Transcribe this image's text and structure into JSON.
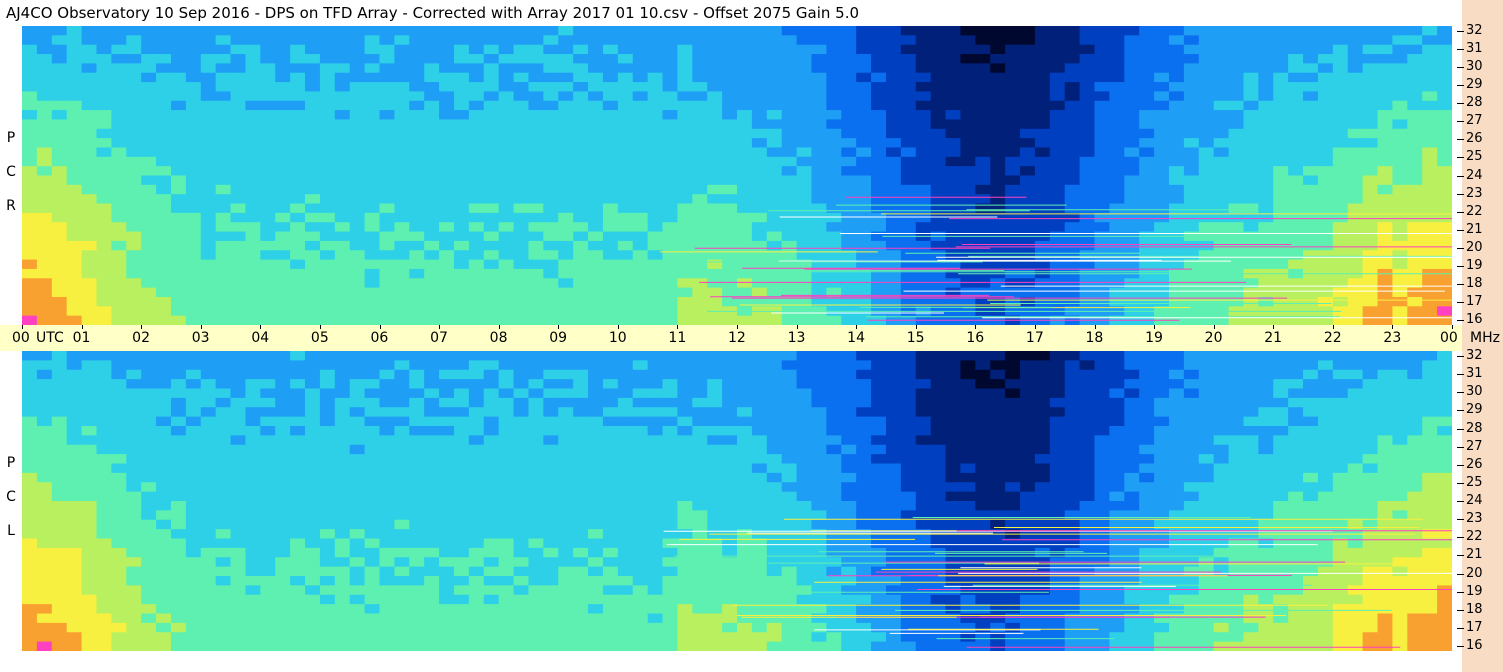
{
  "title": "AJ4CO Observatory  10 Sep 2016  -  DPS on TFD Array  -  Corrected with Array 2017 01 10.csv  -  Offset 2075  Gain 5.0",
  "chart_data": {
    "type": "heatmap",
    "title": "AJ4CO Observatory  10 Sep 2016  -  DPS on TFD Array  -  Corrected with Array 2017 01 10.csv  -  Offset 2075  Gain 5.0",
    "x_axis": {
      "label": "UTC",
      "range": [
        0,
        24
      ],
      "tick_labels": [
        "00",
        "01",
        "02",
        "03",
        "04",
        "05",
        "06",
        "07",
        "08",
        "09",
        "10",
        "11",
        "12",
        "13",
        "14",
        "15",
        "16",
        "17",
        "18",
        "19",
        "20",
        "21",
        "22",
        "23",
        "00"
      ]
    },
    "y_axis": {
      "label": "MHz",
      "range": [
        16,
        32
      ],
      "tick_labels": [
        "16",
        "17",
        "18",
        "19",
        "20",
        "21",
        "22",
        "23",
        "24",
        "25",
        "26",
        "27",
        "28",
        "29",
        "30",
        "31",
        "32"
      ]
    },
    "panels": [
      {
        "name": "R C P",
        "letters": [
          "R",
          "C",
          "P"
        ]
      },
      {
        "name": "L C P",
        "letters": [
          "L",
          "C",
          "P"
        ]
      }
    ],
    "color_map": [
      "#000830",
      "#00207a",
      "#0040c0",
      "#0a70f0",
      "#1e9ef5",
      "#2ed0e8",
      "#5ef0b0",
      "#b8f060",
      "#f8f040",
      "#f8a030",
      "#ff40c0",
      "#ffffff"
    ],
    "grid": false
  }
}
